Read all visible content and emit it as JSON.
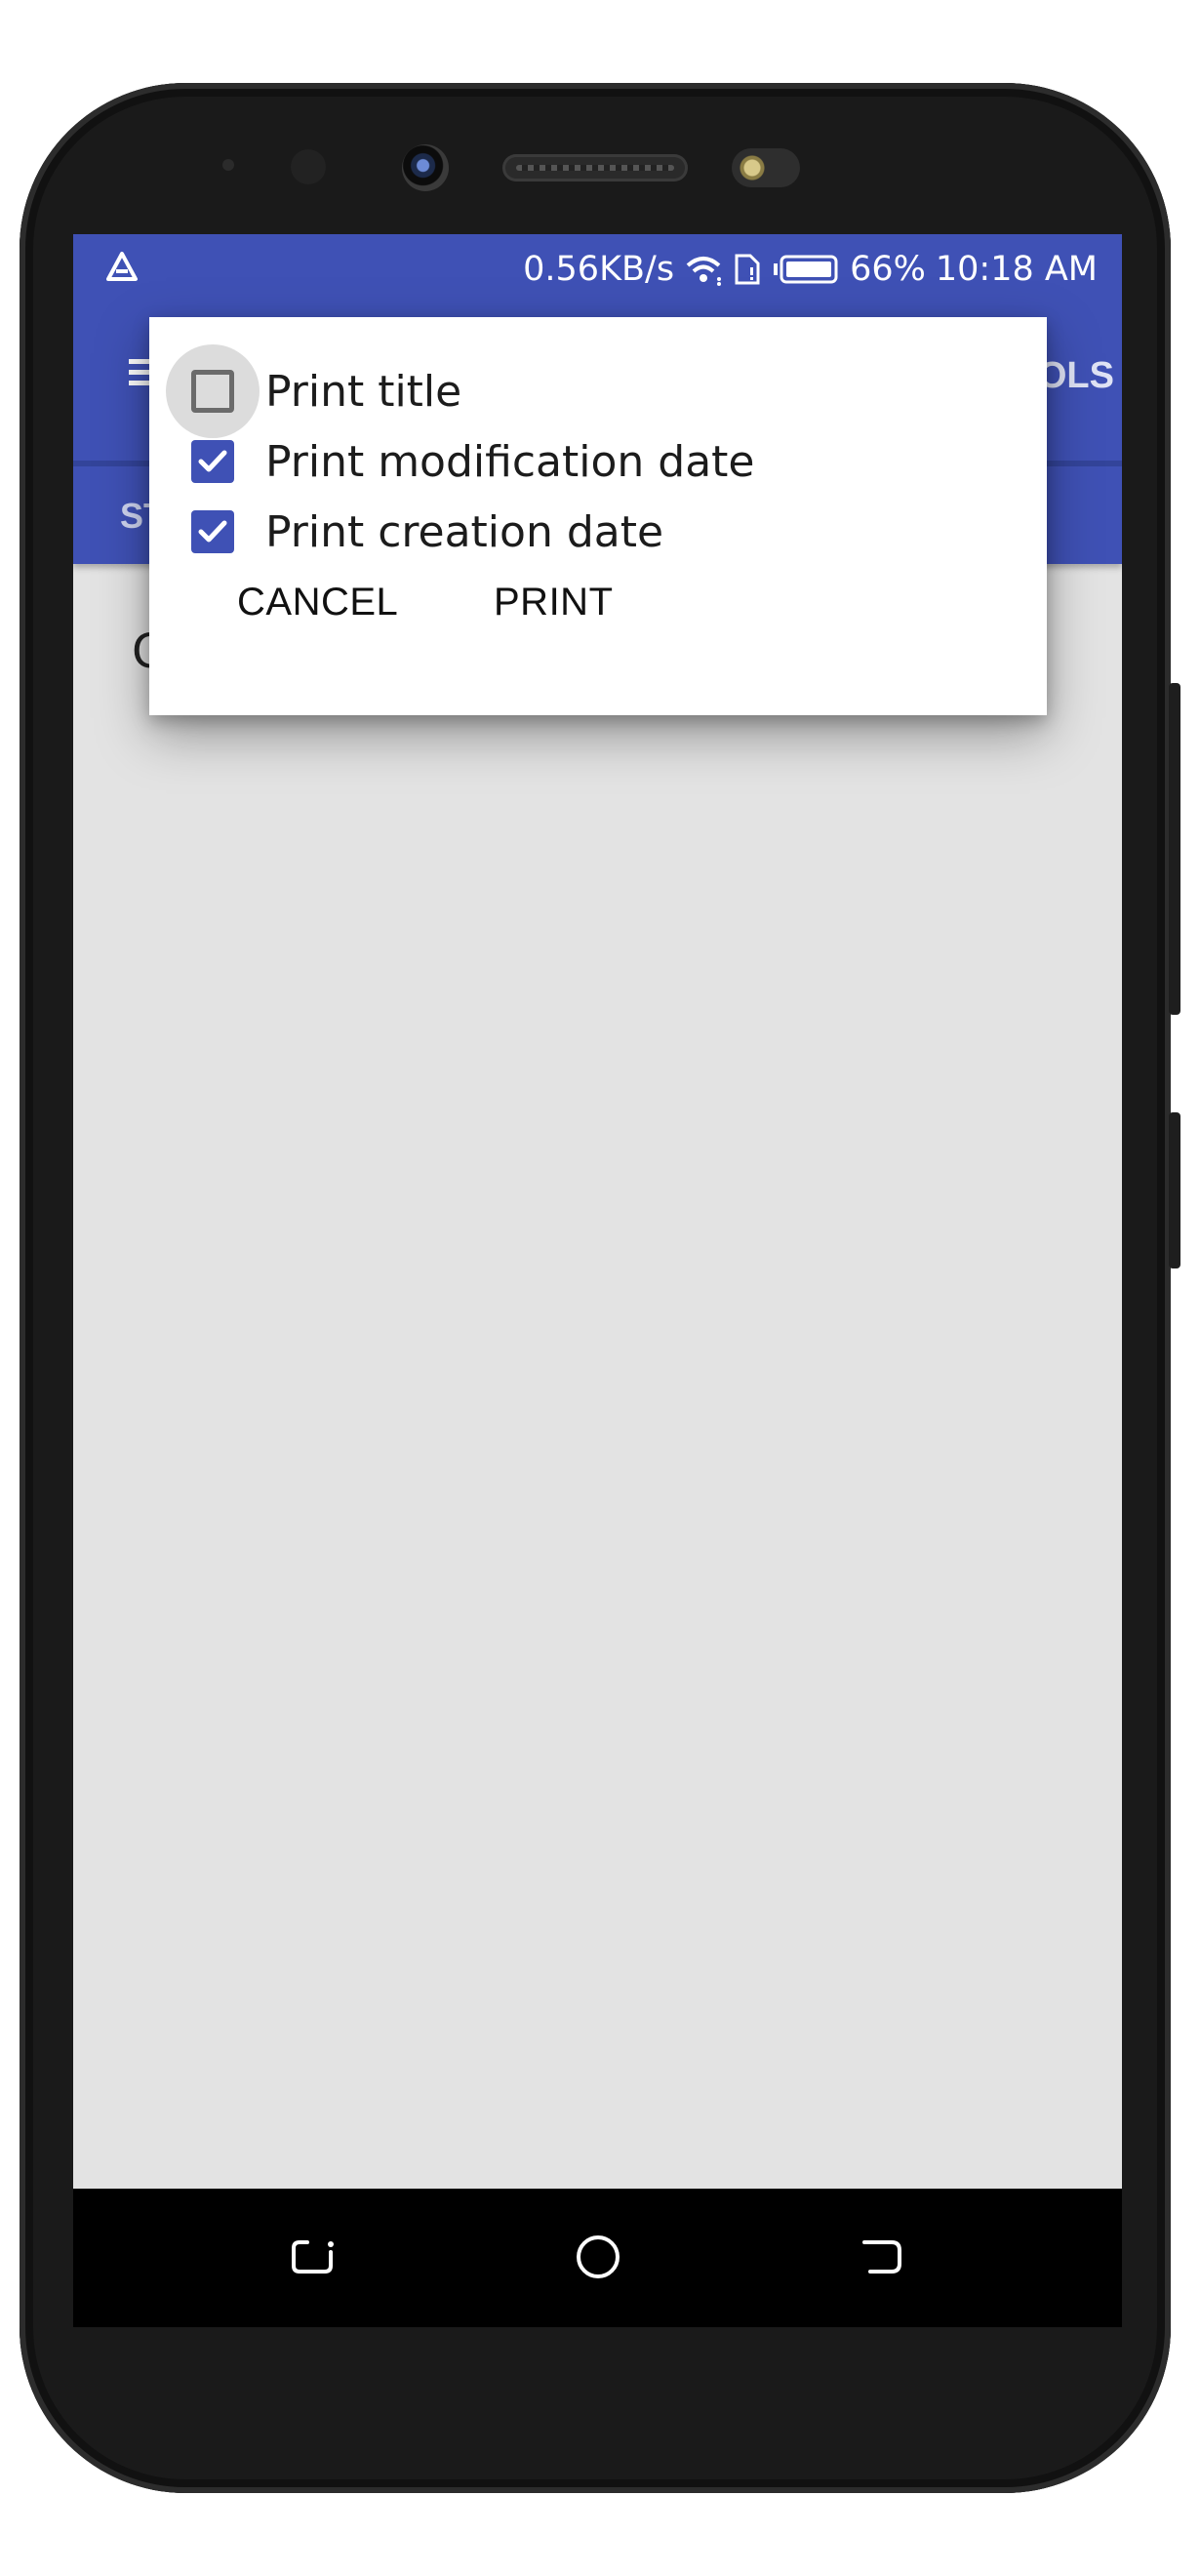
{
  "status_bar": {
    "network_speed": "0.56KB/s",
    "battery": "66%",
    "time": "10:18 AM",
    "icons": [
      "app-notification-icon",
      "wifi-icon",
      "sim-icon",
      "battery-icon"
    ]
  },
  "app_bar": {
    "tools_label_fragment": "OLS",
    "tab_label_fragment": "ST"
  },
  "content": {
    "partial_text": "C"
  },
  "dialog": {
    "options": [
      {
        "label": "Print title",
        "checked": false
      },
      {
        "label": "Print modification date",
        "checked": true
      },
      {
        "label": "Print creation date",
        "checked": true
      }
    ],
    "cancel_label": "CANCEL",
    "print_label": "PRINT"
  },
  "nav_bar": {
    "icons": [
      "back-icon",
      "home-icon",
      "recents-icon"
    ]
  },
  "colors": {
    "primary": "#3f51b5",
    "screen_background": "#e3e3e3",
    "dialog_background": "#ffffff",
    "phone_frame": "#1a1a1a"
  }
}
